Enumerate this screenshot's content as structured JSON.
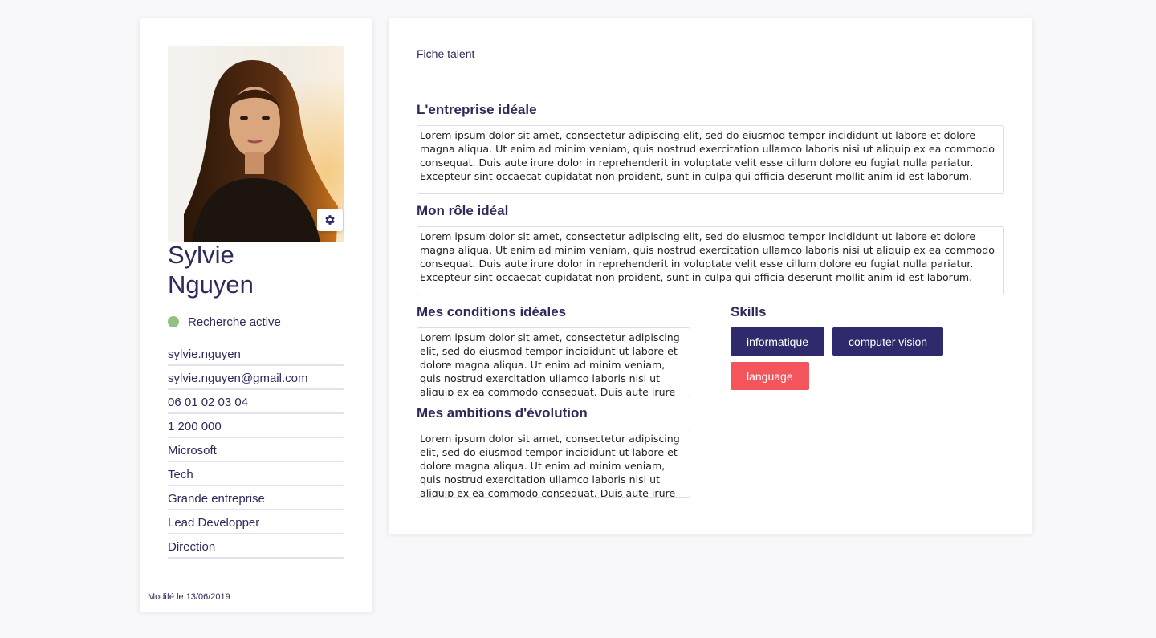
{
  "profile": {
    "first_name": "Sylvie",
    "last_name": "Nguyen",
    "status": "Recherche active",
    "status_color": "#92c283",
    "info": [
      "sylvie.nguyen",
      "sylvie.nguyen@gmail.com",
      "06 01 02 03 04",
      "1 200 000",
      "Microsoft",
      "Tech",
      "Grande entreprise",
      "Lead Developper",
      "Direction"
    ],
    "modified": "Modifé le 13/06/2019",
    "settings_icon": "gear-icon"
  },
  "main": {
    "breadcrumb": "Fiche talent",
    "sections": {
      "entreprise": {
        "title": "L'entreprise idéale",
        "text": "Lorem ipsum dolor sit amet, consectetur adipiscing elit, sed do eiusmod tempor incididunt ut labore et dolore magna aliqua. Ut enim ad minim veniam, quis nostrud exercitation ullamco laboris nisi ut aliquip ex ea commodo consequat. Duis aute irure dolor in reprehenderit in voluptate velit esse cillum dolore eu fugiat nulla pariatur. Excepteur sint occaecat cupidatat non proident, sunt in culpa qui officia deserunt mollit anim id est laborum."
      },
      "role": {
        "title": "Mon rôle idéal",
        "text": "Lorem ipsum dolor sit amet, consectetur adipiscing elit, sed do eiusmod tempor incididunt ut labore et dolore magna aliqua. Ut enim ad minim veniam, quis nostrud exercitation ullamco laboris nisi ut aliquip ex ea commodo consequat. Duis aute irure dolor in reprehenderit in voluptate velit esse cillum dolore eu fugiat nulla pariatur. Excepteur sint occaecat cupidatat non proident, sunt in culpa qui officia deserunt mollit anim id est laborum."
      },
      "conditions": {
        "title": "Mes conditions idéales",
        "text": "Lorem ipsum dolor sit amet, consectetur adipiscing elit, sed do eiusmod tempor incididunt ut labore et dolore magna aliqua. Ut enim ad minim veniam, quis nostrud exercitation ullamco laboris nisi ut aliquip ex ea commodo consequat. Duis aute irure dolor in reprehenderit in voluptate velit esse cillum dolore eu fugiat nulla pariatur."
      },
      "ambitions": {
        "title": "Mes ambitions d'évolution",
        "text": "Lorem ipsum dolor sit amet, consectetur adipiscing elit, sed do eiusmod tempor incididunt ut labore et dolore magna aliqua. Ut enim ad minim veniam, quis nostrud exercitation ullamco laboris nisi ut aliquip ex ea commodo consequat. Duis aute irure dolor in reprehenderit in voluptate velit esse cillum dolore eu fugiat nulla pariatur."
      }
    },
    "skills": {
      "title": "Skills",
      "items": [
        {
          "label": "informatique",
          "color": "#2e2a6b"
        },
        {
          "label": "computer vision",
          "color": "#2e2a6b"
        },
        {
          "label": "language",
          "color": "#f4545c"
        }
      ]
    }
  }
}
